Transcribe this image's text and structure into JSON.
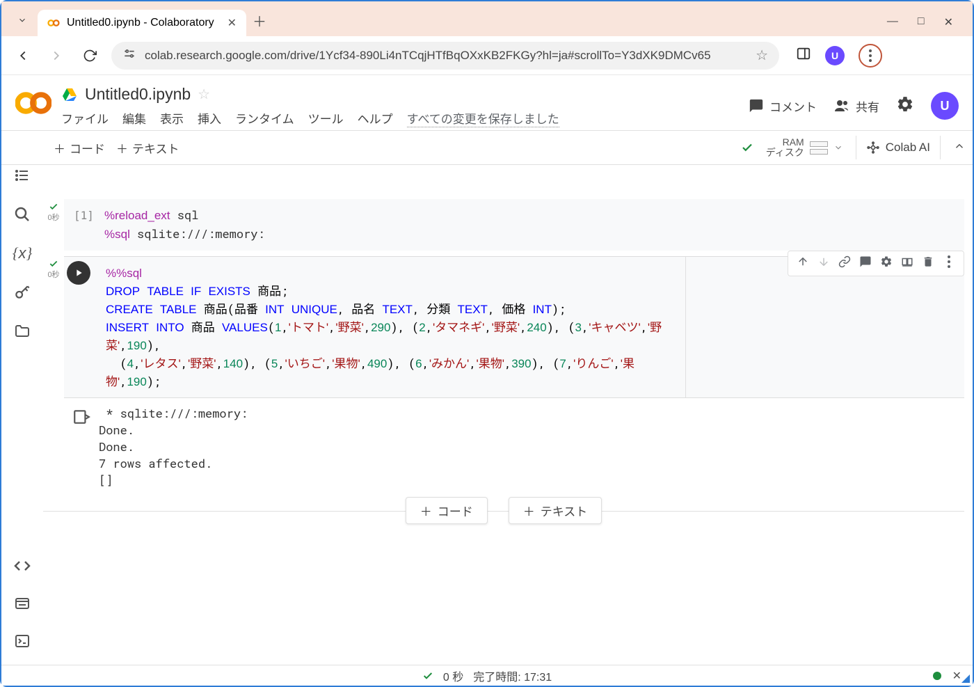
{
  "browser": {
    "tab_title": "Untitled0.ipynb - Colaboratory",
    "url": "colab.research.google.com/drive/1Ycf34-890Li4nTCqjHTfBqOXxKB2FKGy?hl=ja#scrollTo=Y3dXK9DMCv65",
    "avatar_letter": "U"
  },
  "header": {
    "filename": "Untitled0.ipynb",
    "menu": {
      "file": "ファイル",
      "edit": "編集",
      "view": "表示",
      "insert": "挿入",
      "runtime": "ランタイム",
      "tools": "ツール",
      "help": "ヘルプ"
    },
    "save_status": "すべての変更を保存しました",
    "comment": "コメント",
    "share": "共有",
    "avatar_letter": "U"
  },
  "toolbar": {
    "add_code": "コード",
    "add_text": "テキスト",
    "ram_label": "RAM",
    "disk_label": "ディスク",
    "colab_ai": "Colab AI"
  },
  "cells": {
    "c1": {
      "timing": "0秒",
      "prompt": "[1]"
    },
    "c2": {
      "timing": "0秒"
    },
    "output": " * sqlite:///:memory:\nDone.\nDone.\n7 rows affected.\n[]"
  },
  "addbar": {
    "code": "コード",
    "text": "テキスト"
  },
  "status": {
    "sec": "0 秒",
    "done": "完了時間: 17:31"
  }
}
